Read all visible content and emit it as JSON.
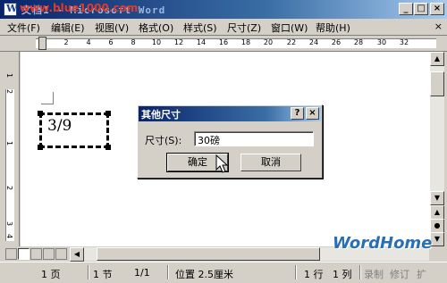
{
  "window": {
    "title": "文档1 - Microsoft Word",
    "watermark": "www.blue1000.com",
    "minimize": "_",
    "restore": "□",
    "close": "×"
  },
  "menu": {
    "items": [
      "文件(F)",
      "编辑(E)",
      "视图(V)",
      "格式(O)",
      "样式(S)",
      "尺寸(Z)",
      "窗口(W)",
      "帮助(H)"
    ],
    "close": "×"
  },
  "ruler": {
    "numbers": [
      "2",
      "4",
      "6",
      "8",
      "10",
      "12",
      "14",
      "16",
      "18",
      "20",
      "22",
      "24",
      "26",
      "28",
      "30",
      "32"
    ],
    "vertical_numbers": [
      "1",
      "2",
      "1",
      "2",
      "3",
      "4"
    ]
  },
  "document": {
    "object_text": "3/9"
  },
  "dialog": {
    "title": "其他尺寸",
    "help_button": "?",
    "close_button": "×",
    "size_label": "尺寸(S):",
    "size_value": "30磅",
    "ok_label": "确定",
    "cancel_label": "取消"
  },
  "status": {
    "page": "1 页",
    "section": "1 节",
    "page_of": "1/1",
    "position": "位置 2.5厘米",
    "line": "1 行",
    "column": "1 列",
    "record": "录制",
    "revise": "修订",
    "extend": "扩"
  },
  "logo": "WordHome",
  "colors": {
    "title_bar": "#0a246a",
    "logo": "#2a6fb3",
    "watermark": "#e03a2a",
    "face": "#d4d0c8"
  }
}
